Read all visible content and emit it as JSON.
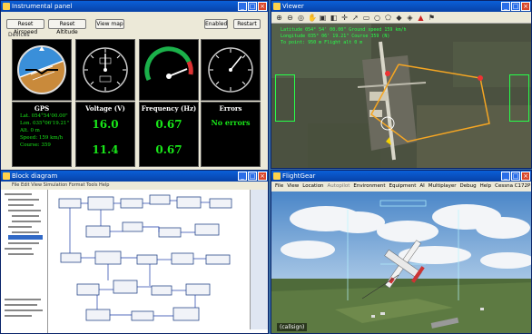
{
  "panel": {
    "title": "Instrumental panel",
    "buttons": [
      "Reset Airspeed",
      "Reset Altitude",
      "View map",
      "Enabled",
      "Restart"
    ],
    "devices_label": "Devices",
    "readouts": {
      "gps": {
        "title": "GPS",
        "lat": "Lat. 054°54'00.00\"",
        "lon": "Lon. 035°06'19.21\"",
        "alt": "Alt. 0 m",
        "speed": "Speed: 159 km/h",
        "course": "Course: 359"
      },
      "voltage": {
        "title": "Voltage (V)",
        "v1": "16.0",
        "v2": "11.4"
      },
      "frequency": {
        "title": "Frequency (Hz)",
        "v1": "0.67",
        "v2": "0.67"
      },
      "errors": {
        "title": "Errors",
        "text": "No errors"
      }
    }
  },
  "viewer": {
    "title": "Viewer",
    "hud": [
      "Latitude 054° 54' 00.00\"  Ground speed 159 km/h",
      "Longitude 035° 06' 19.21\"  Course 359 (N)",
      "To point: 950 m  Flight alt 0 m"
    ]
  },
  "blocks": {
    "title": "Block diagram",
    "menu": "File  Edit  View  Simulation  Format  Tools  Help"
  },
  "flightgear": {
    "title": "FlightGear",
    "menu": [
      "File",
      "View",
      "Location",
      "Autopilot",
      "Environment",
      "Equipment",
      "AI",
      "Multiplayer",
      "Debug",
      "Help",
      "Cessna C172P"
    ],
    "callsign": "(callsign)"
  },
  "colors": {
    "hud_green": "#27ff4a",
    "readout_green": "#19e619",
    "titlebar": "#0a5fd8"
  }
}
